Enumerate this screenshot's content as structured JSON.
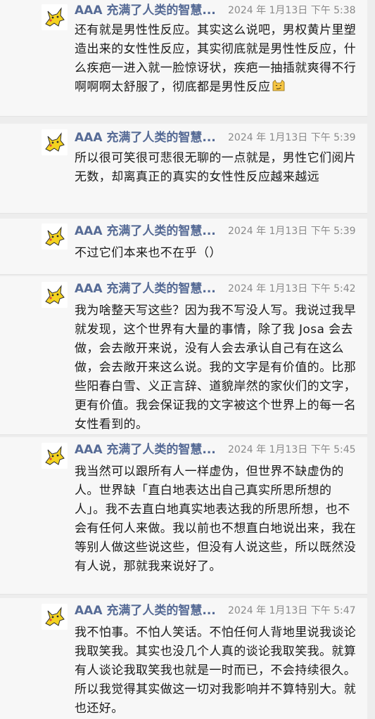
{
  "messages": [
    {
      "sender": "AAA 充满了人类的智慧...",
      "time": "2024 年 1月13日 下午 5:38",
      "text": "还有就是男性性反应。其实这么说吧，男权黄片里塑造出来的女性性反应，其实彻底就是男性性反应，什么疾疤一进入就一脸惊讶状，疾疤一抽插就爽得不行啊啊啊太舒服了，彻底都是男性反应",
      "emoji": "cat-smirk-emoji"
    },
    {
      "sender": "AAA 充满了人类的智慧...",
      "time": "2024 年 1月13日 下午 5:39",
      "text": "所以很可笑很可悲很无聊的一点就是，男性它们阅片无数，却离真正的真实的女性性反应越来越远"
    },
    {
      "sender": "AAA 充满了人类的智慧...",
      "time": "2024 年 1月13日 下午 5:39",
      "text": "不过它们本来也不在乎（）"
    },
    {
      "sender": "AAA 充满了人类的智慧...",
      "time": "2024 年 1月13日 下午 5:42",
      "text": "我为啥整天写这些？因为我不写没人写。我说过我早就发现，这个世界有大量的事情，除了我 Josa 会去做，会去敞开来说，没有人会去承认自己有在这么做，会去敞开来这么说。我的文字是有价值的。比那些阳春白雪、义正言辞、道貌岸然的家伙们的文字，更有价值。我会保证我的文字被这个世界上的每一名女性看到的。"
    },
    {
      "sender": "AAA 充满了人类的智慧...",
      "time": "2024 年 1月13日 下午 5:45",
      "text": "我当然可以跟所有人一样虚伪，但世界不缺虚伪的人。世界缺「直白地表达出自己真实所思所想的人」。我不去直白地真实地表达我的所思所想，也不会有任何人来做。我以前也不想直白地说出来，我在等别人做这些说这些，但没有人说这些，所以既然没有人说，那就我来说好了。"
    },
    {
      "sender": "AAA 充满了人类的智慧...",
      "time": "2024 年 1月13日 下午 5:47",
      "text": "我不怕事。不怕人笑话。不怕任何人背地里说我谈论我取笑我。其实也没几个人真的谈论我取笑我。就算有人谈论我取笑我也就是一时而已，不会持续很久。所以我觉得其实做这一切对我影响并不算特别大。就也还好。"
    }
  ]
}
